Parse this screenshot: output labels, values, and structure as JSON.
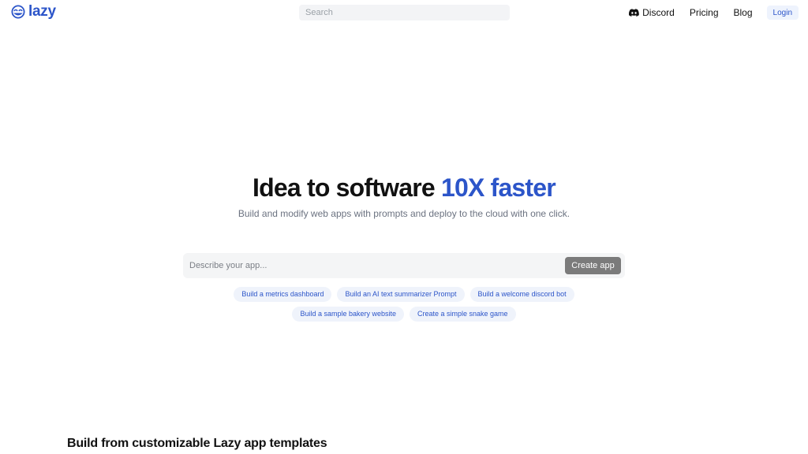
{
  "header": {
    "logo_text": "lazy",
    "logo_icon": "lazy-face-icon",
    "search_placeholder": "Search",
    "nav": {
      "discord_label": "Discord",
      "discord_icon": "discord-icon",
      "pricing_label": "Pricing",
      "blog_label": "Blog",
      "login_label": "Login"
    }
  },
  "hero": {
    "title_main": "Idea to software ",
    "title_accent": "10X faster",
    "subtitle": "Build and modify web apps with prompts and deploy to the cloud with one click.",
    "prompt_placeholder": "Describe your app...",
    "create_button_label": "Create app",
    "suggestions_row1": [
      "Build a metrics dashboard",
      "Build an AI text summarizer Prompt",
      "Build a welcome discord bot"
    ],
    "suggestions_row2": [
      "Build a sample bakery website",
      "Create a simple snake game"
    ]
  },
  "templates_section": {
    "title": "Build from customizable Lazy app templates"
  },
  "colors": {
    "accent": "#2c55c9",
    "chip_background": "#eff3fb",
    "create_button": "#7b7b7b"
  }
}
